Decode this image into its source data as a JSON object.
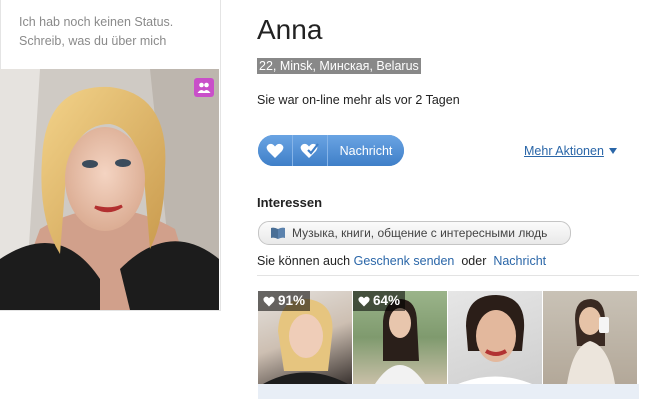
{
  "profile": {
    "status_line1": "Ich hab noch keinen Status.",
    "status_line2": "Schreib, was du über mich",
    "name": "Anna",
    "location": "22, Minsk, Минская, Belarus",
    "online_status": "Sie war on-line mehr als vor 2 Tagen"
  },
  "actions": {
    "like_icon": "heart-icon",
    "wink_icon": "heart-check-icon",
    "message_label": "Nachricht",
    "more_actions_label": "Mehr Aktionen"
  },
  "interests": {
    "heading": "Interessen",
    "tag_icon": "book-icon",
    "tag_text": "Музыка, книги, общение с интересными людь"
  },
  "gift_line": {
    "prefix": "Sie können auch",
    "gift_link": "Geschenk senden",
    "or_word": "oder",
    "message_link": "Nachricht"
  },
  "photos": [
    {
      "match": "91%"
    },
    {
      "match": "64%"
    },
    {
      "match": ""
    },
    {
      "match": ""
    }
  ],
  "colors": {
    "accent_blue": "#3f7fc8",
    "link_blue": "#2a66a8",
    "badge_purple": "#c94fc9",
    "location_bg": "#888888"
  }
}
